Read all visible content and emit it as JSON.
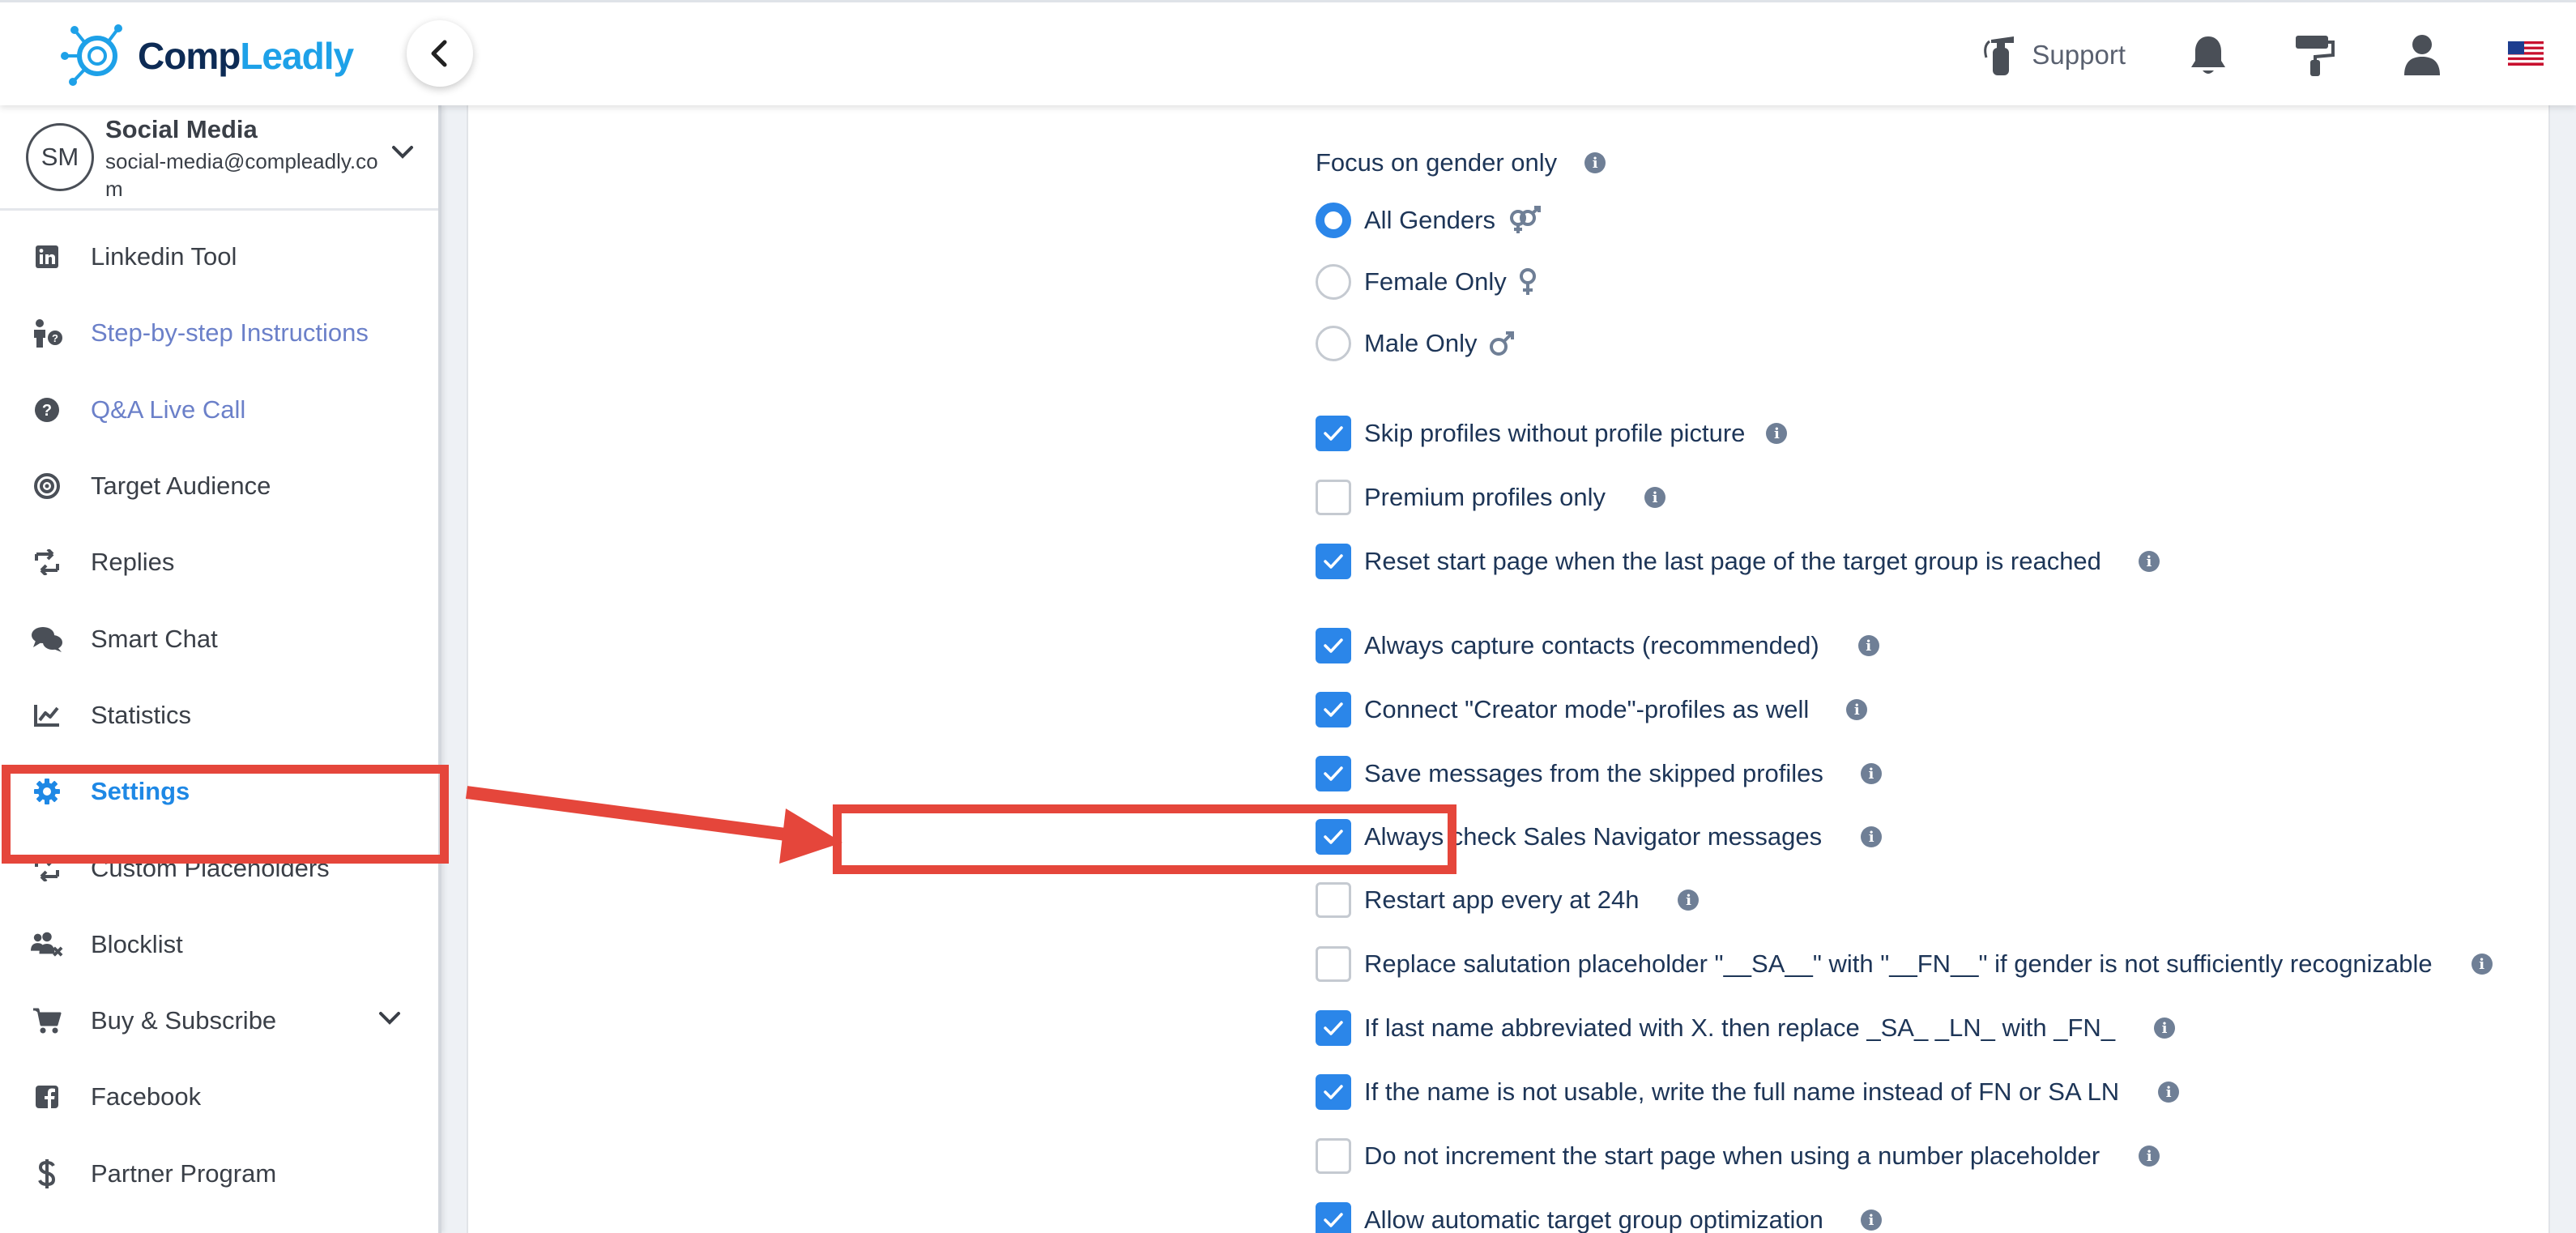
{
  "app": {
    "logo_text_1": "Comp",
    "logo_text_2": "Leadly",
    "logo_text_full": "CompLeadly"
  },
  "header": {
    "support_label": "Support",
    "icons": [
      "fire-extinguisher-icon",
      "bell-icon",
      "paint-roller-icon",
      "user-icon",
      "us-flag-icon"
    ]
  },
  "account": {
    "initials": "SM",
    "name": "Social Media",
    "email": "social-media@compleadly.com"
  },
  "sidebar": {
    "items": [
      {
        "label": "Linkedin Tool",
        "icon": "linkedin-icon",
        "style": "normal"
      },
      {
        "label": "Step-by-step Instructions",
        "icon": "person-question-icon",
        "style": "link"
      },
      {
        "label": "Q&A Live Call",
        "icon": "question-circle-icon",
        "style": "link"
      },
      {
        "label": "Target Audience",
        "icon": "target-icon",
        "style": "normal"
      },
      {
        "label": "Replies",
        "icon": "replies-icon",
        "style": "normal"
      },
      {
        "label": "Smart Chat",
        "icon": "chat-bubbles-icon",
        "style": "normal"
      },
      {
        "label": "Statistics",
        "icon": "line-chart-icon",
        "style": "normal"
      },
      {
        "label": "Settings",
        "icon": "gear-icon",
        "style": "active"
      },
      {
        "label": "Custom Placeholders",
        "icon": "placeholder-icon",
        "style": "normal"
      },
      {
        "label": "Blocklist",
        "icon": "users-block-icon",
        "style": "normal"
      },
      {
        "label": "Buy & Subscribe",
        "icon": "cart-icon",
        "style": "normal",
        "expandable": true
      },
      {
        "label": "Facebook",
        "icon": "facebook-icon",
        "style": "normal"
      },
      {
        "label": "Partner Program",
        "icon": "dollar-icon",
        "style": "normal"
      }
    ]
  },
  "settings": {
    "gender_title": "Focus on gender only",
    "gender_options": [
      {
        "label": "All Genders",
        "selected": true,
        "icon": "genderless-icon"
      },
      {
        "label": "Female Only",
        "selected": false,
        "icon": "venus-icon"
      },
      {
        "label": "Male Only",
        "selected": false,
        "icon": "mars-icon"
      }
    ],
    "options": [
      {
        "label": "Skip profiles without profile picture",
        "checked": true
      },
      {
        "label": "Premium profiles only",
        "checked": false
      },
      {
        "label": "Reset start page when the last page of the target group is reached",
        "checked": true
      },
      {
        "label": "Always capture contacts (recommended)",
        "checked": true
      },
      {
        "label": "Connect \"Creator mode\"-profiles as well",
        "checked": true
      },
      {
        "label": "Save messages from the skipped profiles",
        "checked": true
      },
      {
        "label": "Always check Sales Navigator messages",
        "checked": true
      },
      {
        "label": "Restart app every at 24h",
        "checked": false
      },
      {
        "label": "Replace salutation placeholder \"__SA__\" with \"__FN__\" if gender is not sufficiently recognizable",
        "checked": false
      },
      {
        "label": "If last name abbreviated with X. then replace _SA_ _LN_ with _FN_",
        "checked": true
      },
      {
        "label": "If the name is not usable, write the full name instead of FN or SA LN",
        "checked": true
      },
      {
        "label": "Do not increment the start page when using a number placeholder",
        "checked": false
      },
      {
        "label": "Allow automatic target group optimization",
        "checked": true
      }
    ],
    "info_glyph": "i"
  },
  "colors": {
    "accent": "#2b86e9",
    "annotation": "#e5463b",
    "text": "#1d3557",
    "link": "#6b80c9"
  }
}
